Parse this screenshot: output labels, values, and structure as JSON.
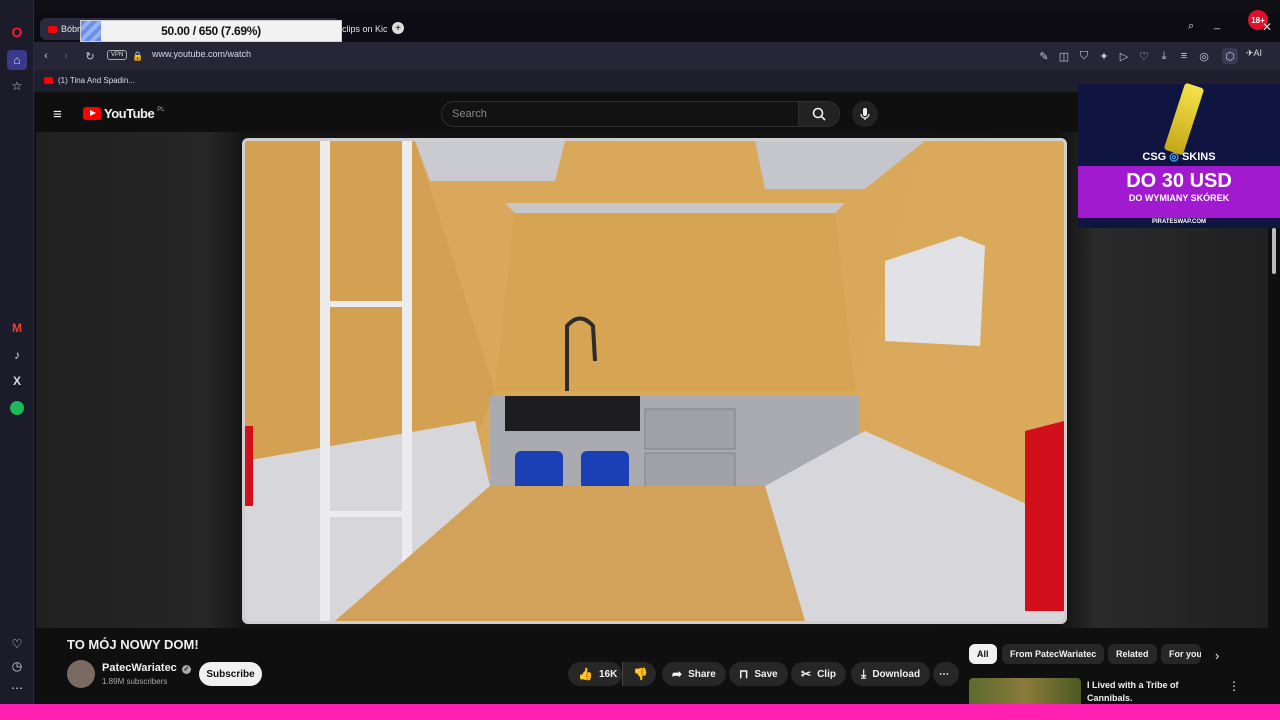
{
  "browser": {
    "tabs": [
      {
        "label": "Bóbr"
      },
      {
        "label": "clips on Kic"
      }
    ],
    "progress": {
      "text": "50.00 / 650 (7.69%)",
      "fraction": 0.0769
    },
    "url": "www.youtube.com/watch",
    "vpn_label": "VPN",
    "ai_label": "AI",
    "bookmark": "(1) Tina And Spadin...",
    "badge": "18+"
  },
  "youtube": {
    "logo_text": "YouTube",
    "logo_country": "PL",
    "search_placeholder": "Search"
  },
  "ad": {
    "brand": "CSG",
    "brand_suffix": "SKINS",
    "headline": "DO 30 USD",
    "subline": "DO WYMIANY SKÓREK",
    "domain": "PIRATESWAP.COM"
  },
  "video": {
    "title": "TO MÓJ NOWY DOM!",
    "channel": "PatecWariatec",
    "subscribers": "1.89M subscribers",
    "subscribe_label": "Subscribe",
    "likes": "16K",
    "share_label": "Share",
    "save_label": "Save",
    "clip_label": "Clip",
    "download_label": "Download"
  },
  "chips": [
    "All",
    "From PatecWariatec",
    "Related",
    "For you"
  ],
  "recommended": {
    "title_line1": "I Lived with a Tribe of",
    "title_line2": "Cannibals."
  },
  "colors": {
    "opera_red": "#ff1b2d",
    "yt_red": "#ff0000",
    "bottom_bar": "#ff1fb0"
  }
}
